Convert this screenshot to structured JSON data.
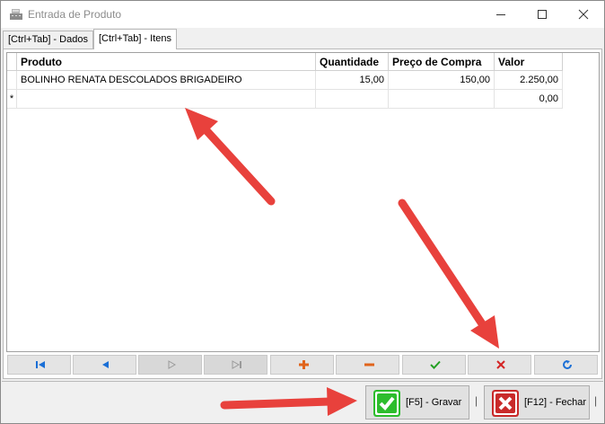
{
  "window": {
    "title": "Entrada de Produto"
  },
  "tabs": [
    {
      "label": "[Ctrl+Tab] - Dados"
    },
    {
      "label": "[Ctrl+Tab] - Itens"
    }
  ],
  "grid": {
    "columns": {
      "produto": "Produto",
      "quantidade": "Quantidade",
      "preco": "Preço de Compra",
      "valor": "Valor"
    },
    "rows": [
      {
        "indicator": "",
        "produto": "BOLINHO RENATA DESCOLADOS BRIGADEIRO",
        "quantidade": "15,00",
        "preco": "150,00",
        "valor": "2.250,00"
      },
      {
        "indicator": "*",
        "produto": "",
        "quantidade": "",
        "preco": "",
        "valor": "0,00"
      }
    ]
  },
  "navigator": {
    "buttons": [
      "first-icon",
      "prior-icon",
      "next-icon",
      "last-icon",
      "insert-icon",
      "delete-icon",
      "post-icon",
      "cancel-icon",
      "refresh-icon"
    ]
  },
  "footer": {
    "save_label": "[F5] - Gravar",
    "close_label": "[F12] - Fechar",
    "separator": "|"
  },
  "colors": {
    "arrow": "#e8413c",
    "save": "#2dbd2d",
    "close": "#c92a2a",
    "nav_icon": "#1a6fd6"
  }
}
